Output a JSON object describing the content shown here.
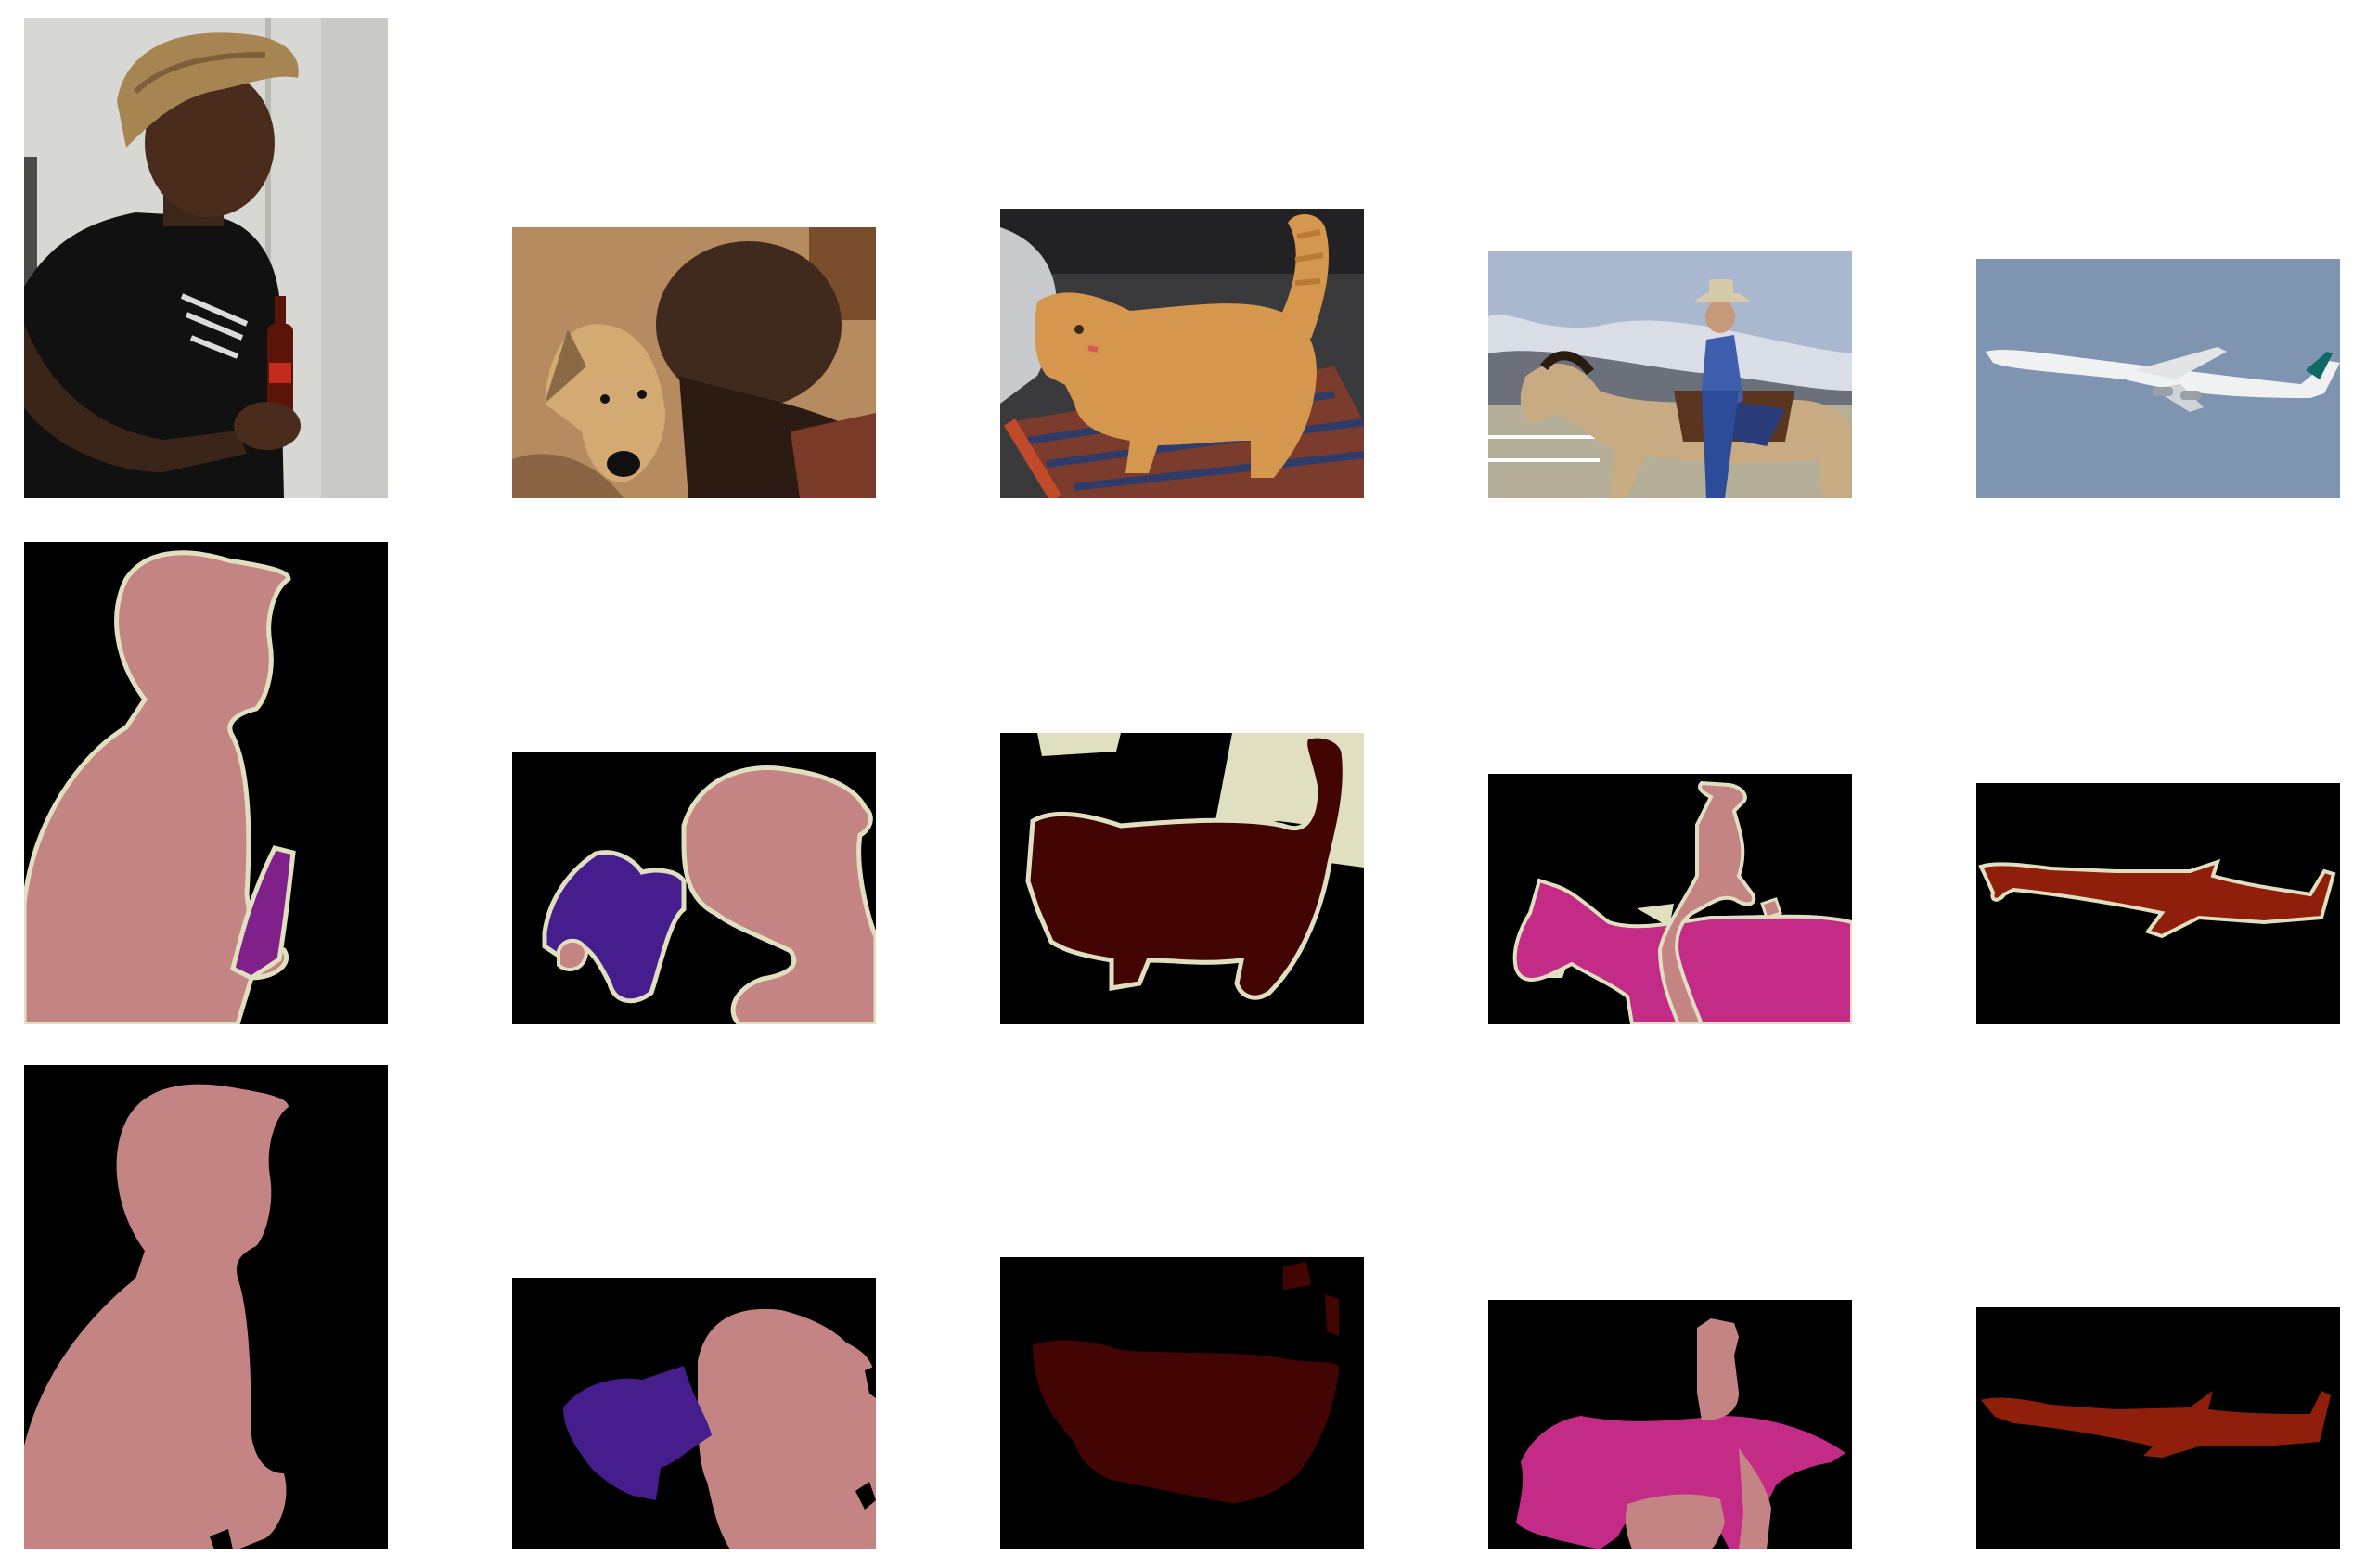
{
  "figure": {
    "rows": [
      "input-image",
      "ground-truth-mask",
      "predicted-mask"
    ],
    "columns": [
      {
        "subject": "person-with-bottle",
        "classes": [
          "person",
          "bottle"
        ]
      },
      {
        "subject": "dog-and-child",
        "classes": [
          "dog",
          "person"
        ]
      },
      {
        "subject": "cat-on-rug",
        "classes": [
          "cat"
        ]
      },
      {
        "subject": "rider-on-horse",
        "classes": [
          "person",
          "horse"
        ]
      },
      {
        "subject": "airplane-in-sky",
        "classes": [
          "aeroplane"
        ]
      }
    ],
    "palette": {
      "background": "#000000",
      "boundary": "#e0dfc0",
      "person": "#c48484",
      "bottle": "#80208a",
      "dog": "#461d8c",
      "cat": "#430404",
      "horse": "#c32b87",
      "aeroplane": "#8f1f0b"
    }
  }
}
